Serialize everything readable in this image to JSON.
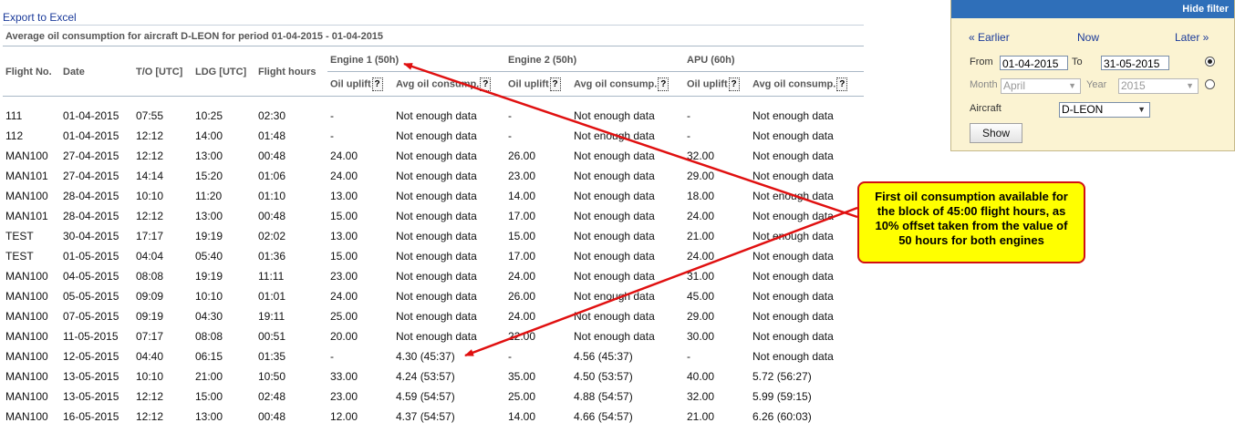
{
  "export_link": "Export to Excel",
  "report_title": "Average oil consumption for aircraft D-LEON for period 01-04-2015 - 01-04-2015",
  "table": {
    "columns": {
      "flight_no": "Flight No.",
      "date": "Date",
      "to": "T/O [UTC]",
      "ldg": "LDG [UTC]",
      "flight_hours": "Flight hours"
    },
    "groups": [
      "Engine 1 (50h)",
      "Engine 2 (50h)",
      "APU (60h)"
    ],
    "sub_uplift": "Oil uplift",
    "sub_avg": "Avg oil consump.",
    "help_glyph": "?",
    "rows": [
      [
        "111",
        "01-04-2015",
        "07:55",
        "10:25",
        "02:30",
        "-",
        "Not enough data",
        "-",
        "Not enough data",
        "-",
        "Not enough data"
      ],
      [
        "112",
        "01-04-2015",
        "12:12",
        "14:00",
        "01:48",
        "-",
        "Not enough data",
        "-",
        "Not enough data",
        "-",
        "Not enough data"
      ],
      [
        "MAN100",
        "27-04-2015",
        "12:12",
        "13:00",
        "00:48",
        "24.00",
        "Not enough data",
        "26.00",
        "Not enough data",
        "32.00",
        "Not enough data"
      ],
      [
        "MAN101",
        "27-04-2015",
        "14:14",
        "15:20",
        "01:06",
        "24.00",
        "Not enough data",
        "23.00",
        "Not enough data",
        "29.00",
        "Not enough data"
      ],
      [
        "MAN100",
        "28-04-2015",
        "10:10",
        "11:20",
        "01:10",
        "13.00",
        "Not enough data",
        "14.00",
        "Not enough data",
        "18.00",
        "Not enough data"
      ],
      [
        "MAN101",
        "28-04-2015",
        "12:12",
        "13:00",
        "00:48",
        "15.00",
        "Not enough data",
        "17.00",
        "Not enough data",
        "24.00",
        "Not enough data"
      ],
      [
        "TEST",
        "30-04-2015",
        "17:17",
        "19:19",
        "02:02",
        "13.00",
        "Not enough data",
        "15.00",
        "Not enough data",
        "21.00",
        "Not enough data"
      ],
      [
        "TEST",
        "01-05-2015",
        "04:04",
        "05:40",
        "01:36",
        "15.00",
        "Not enough data",
        "17.00",
        "Not enough data",
        "24.00",
        "Not enough data"
      ],
      [
        "MAN100",
        "04-05-2015",
        "08:08",
        "19:19",
        "11:11",
        "23.00",
        "Not enough data",
        "24.00",
        "Not enough data",
        "31.00",
        "Not enough data"
      ],
      [
        "MAN100",
        "05-05-2015",
        "09:09",
        "10:10",
        "01:01",
        "24.00",
        "Not enough data",
        "26.00",
        "Not enough data",
        "45.00",
        "Not enough data"
      ],
      [
        "MAN100",
        "07-05-2015",
        "09:19",
        "04:30",
        "19:11",
        "25.00",
        "Not enough data",
        "24.00",
        "Not enough data",
        "29.00",
        "Not enough data"
      ],
      [
        "MAN100",
        "11-05-2015",
        "07:17",
        "08:08",
        "00:51",
        "20.00",
        "Not enough data",
        "22.00",
        "Not enough data",
        "30.00",
        "Not enough data"
      ],
      [
        "MAN100",
        "12-05-2015",
        "04:40",
        "06:15",
        "01:35",
        "-",
        "4.30 (45:37)",
        "-",
        "4.56 (45:37)",
        "-",
        "Not enough data"
      ],
      [
        "MAN100",
        "13-05-2015",
        "10:10",
        "21:00",
        "10:50",
        "33.00",
        "4.24 (53:57)",
        "35.00",
        "4.50 (53:57)",
        "40.00",
        "5.72 (56:27)"
      ],
      [
        "MAN100",
        "13-05-2015",
        "12:12",
        "15:00",
        "02:48",
        "23.00",
        "4.59 (54:57)",
        "25.00",
        "4.88 (54:57)",
        "32.00",
        "5.99 (59:15)"
      ],
      [
        "MAN100",
        "16-05-2015",
        "12:12",
        "13:00",
        "00:48",
        "12.00",
        "4.37 (54:57)",
        "14.00",
        "4.66 (54:57)",
        "21.00",
        "6.26 (60:03)"
      ]
    ]
  },
  "filter": {
    "hide_label": "Hide filter",
    "earlier": "« Earlier",
    "now": "Now",
    "later": "Later »",
    "from_label": "From",
    "from_value": "01-04-2015",
    "to_label": "To",
    "to_value": "31-05-2015",
    "month_label": "Month",
    "month_value": "April",
    "year_label": "Year",
    "year_value": "2015",
    "aircraft_label": "Aircraft",
    "aircraft_value": "D-LEON",
    "show_label": "Show",
    "arrow_glyph": "▼"
  },
  "annotation": {
    "text": "First oil consumption available for\nthe block of 45:00 flight hours, as\n10% offset taken from the value of\n50 hours for both engines",
    "color": "#e01010",
    "fill": "#ffff00"
  }
}
